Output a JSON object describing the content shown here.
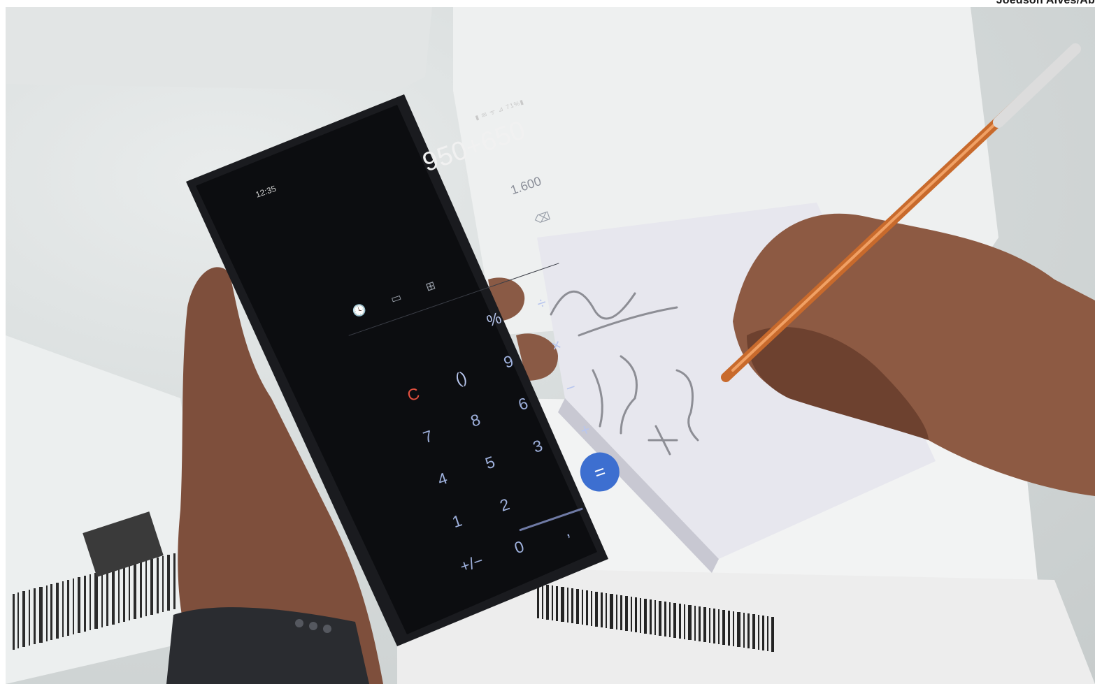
{
  "credit": "Joédson Alves/Ab",
  "phone": {
    "status_time": "12:35",
    "status_icons": "▮ ✉ ᯤ ⊿ 71%▮",
    "expression": "950+650",
    "result": "1.600",
    "tools": [
      {
        "icon": "history-icon",
        "glyph": "🕓"
      },
      {
        "icon": "ruler-icon",
        "glyph": "▭"
      },
      {
        "icon": "scientific-mode-icon",
        "glyph": "⊞"
      }
    ],
    "backspace_glyph": "⌫",
    "keys": [
      {
        "label": "",
        "name": "key-empty"
      },
      {
        "label": "",
        "name": "key-empty"
      },
      {
        "label": "%",
        "name": "key-percent"
      },
      {
        "label": "÷",
        "name": "key-divide"
      },
      {
        "label": "C",
        "name": "key-clear"
      },
      {
        "label": "()",
        "name": "key-parentheses"
      },
      {
        "label": "9",
        "name": "key-9"
      },
      {
        "label": "×",
        "name": "key-multiply"
      },
      {
        "label": "7",
        "name": "key-7"
      },
      {
        "label": "8",
        "name": "key-8"
      },
      {
        "label": "6",
        "name": "key-6"
      },
      {
        "label": "−",
        "name": "key-subtract"
      },
      {
        "label": "4",
        "name": "key-4"
      },
      {
        "label": "5",
        "name": "key-5"
      },
      {
        "label": "3",
        "name": "key-3"
      },
      {
        "label": "+",
        "name": "key-add"
      },
      {
        "label": "1",
        "name": "key-1"
      },
      {
        "label": "2",
        "name": "key-2"
      },
      {
        "label": "",
        "name": "key-empty"
      },
      {
        "label": "=",
        "name": "key-equals"
      },
      {
        "label": "+/−",
        "name": "key-sign"
      },
      {
        "label": "0",
        "name": "key-0"
      },
      {
        "label": ",",
        "name": "key-decimal"
      },
      {
        "label": "",
        "name": "key-empty"
      }
    ]
  },
  "colors": {
    "screen_bg": "#0c0d10",
    "key_text": "#9fb1dd",
    "clear_key": "#e3503f",
    "equals_key": "#3d6fd0"
  }
}
